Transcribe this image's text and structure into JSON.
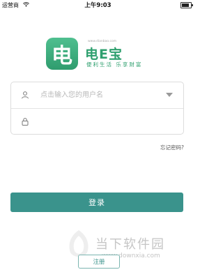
{
  "status_bar": {
    "carrier": "运营商",
    "time": "上午9:03"
  },
  "logo": {
    "glyph": "电",
    "url": "www.dianbao.com",
    "brand": "电E宝",
    "slogan": "便利生活 乐享财富"
  },
  "form": {
    "username_placeholder": "点击输入您的用户名",
    "password_placeholder": ""
  },
  "forgot_password": "忘记密码?",
  "login_button": "登录",
  "register_button": "注册",
  "watermark": {
    "text": "当下软件园",
    "url": "www.downxia.com"
  },
  "colors": {
    "brand_green": "#2e9f6e",
    "button_teal": "#3a938c"
  }
}
